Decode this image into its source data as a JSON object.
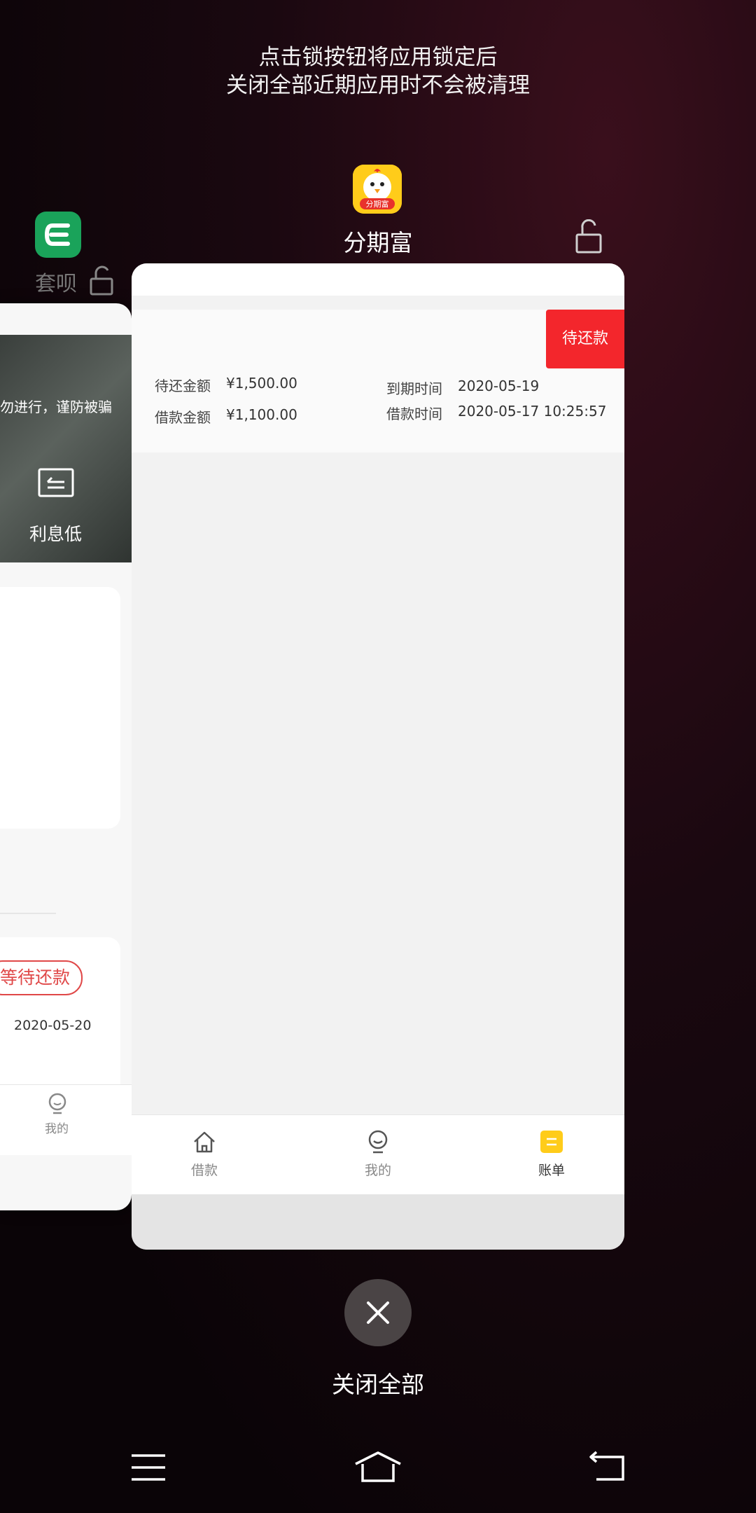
{
  "hint": {
    "line1": "点击锁按钮将应用锁定后",
    "line2": "关闭全部近期应用时不会被清理"
  },
  "left_app": {
    "name": "套呗",
    "fraud_text": "勿进行，谨防被骗",
    "feature_label": "利息低",
    "bill_status": "等待还款",
    "bill_date": "2020-05-20",
    "tab_label": "我的",
    "icon_color": "#1aa35a"
  },
  "main_app": {
    "name": "分期富",
    "icon_label": "分期富",
    "status_badge": "待还款",
    "fields": {
      "repay_amount_label": "待还金额",
      "repay_amount_value": "¥1,500.00",
      "loan_amount_label": "借款金额",
      "loan_amount_value": "¥1,100.00",
      "due_time_label": "到期时间",
      "due_time_value": "2020-05-19",
      "loan_time_label": "借款时间",
      "loan_time_value": "2020-05-17 10:25:57"
    },
    "tabs": [
      {
        "label": "借款",
        "icon": "home-icon"
      },
      {
        "label": "我的",
        "icon": "profile-icon"
      },
      {
        "label": "账单",
        "icon": "bill-icon"
      }
    ],
    "accent": "#ffcc1a",
    "status_color": "#f3262c"
  },
  "close_all_label": "关闭全部",
  "navbar": [
    "menu-icon",
    "home-icon",
    "back-icon"
  ]
}
